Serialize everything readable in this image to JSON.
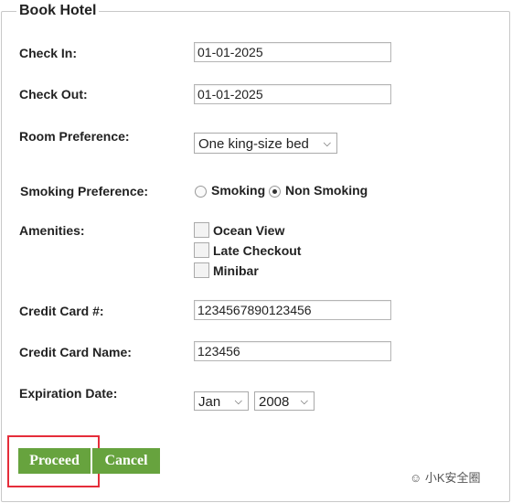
{
  "form": {
    "title": "Book Hotel",
    "check_in": {
      "label": "Check In:",
      "value": "01-01-2025"
    },
    "check_out": {
      "label": "Check Out:",
      "value": "01-01-2025"
    },
    "room": {
      "label": "Room Preference:",
      "value": "One king-size bed"
    },
    "smoking": {
      "label": "Smoking Preference:",
      "options": [
        "Smoking",
        "Non Smoking"
      ],
      "selected": "Non Smoking"
    },
    "amenities": {
      "label": "Amenities:",
      "options": [
        "Ocean View",
        "Late Checkout",
        "Minibar"
      ]
    },
    "cc_number": {
      "label": "Credit Card #:",
      "value": "1234567890123456"
    },
    "cc_name": {
      "label": "Credit Card Name:",
      "value": "123456"
    },
    "expiration": {
      "label": "Expiration Date:",
      "month": "Jan",
      "year": "2008"
    },
    "proceed": "Proceed",
    "cancel": "Cancel"
  },
  "watermark": "小K安全圈",
  "colors": {
    "button": "#67a33e",
    "highlight": "#e52d3a"
  }
}
